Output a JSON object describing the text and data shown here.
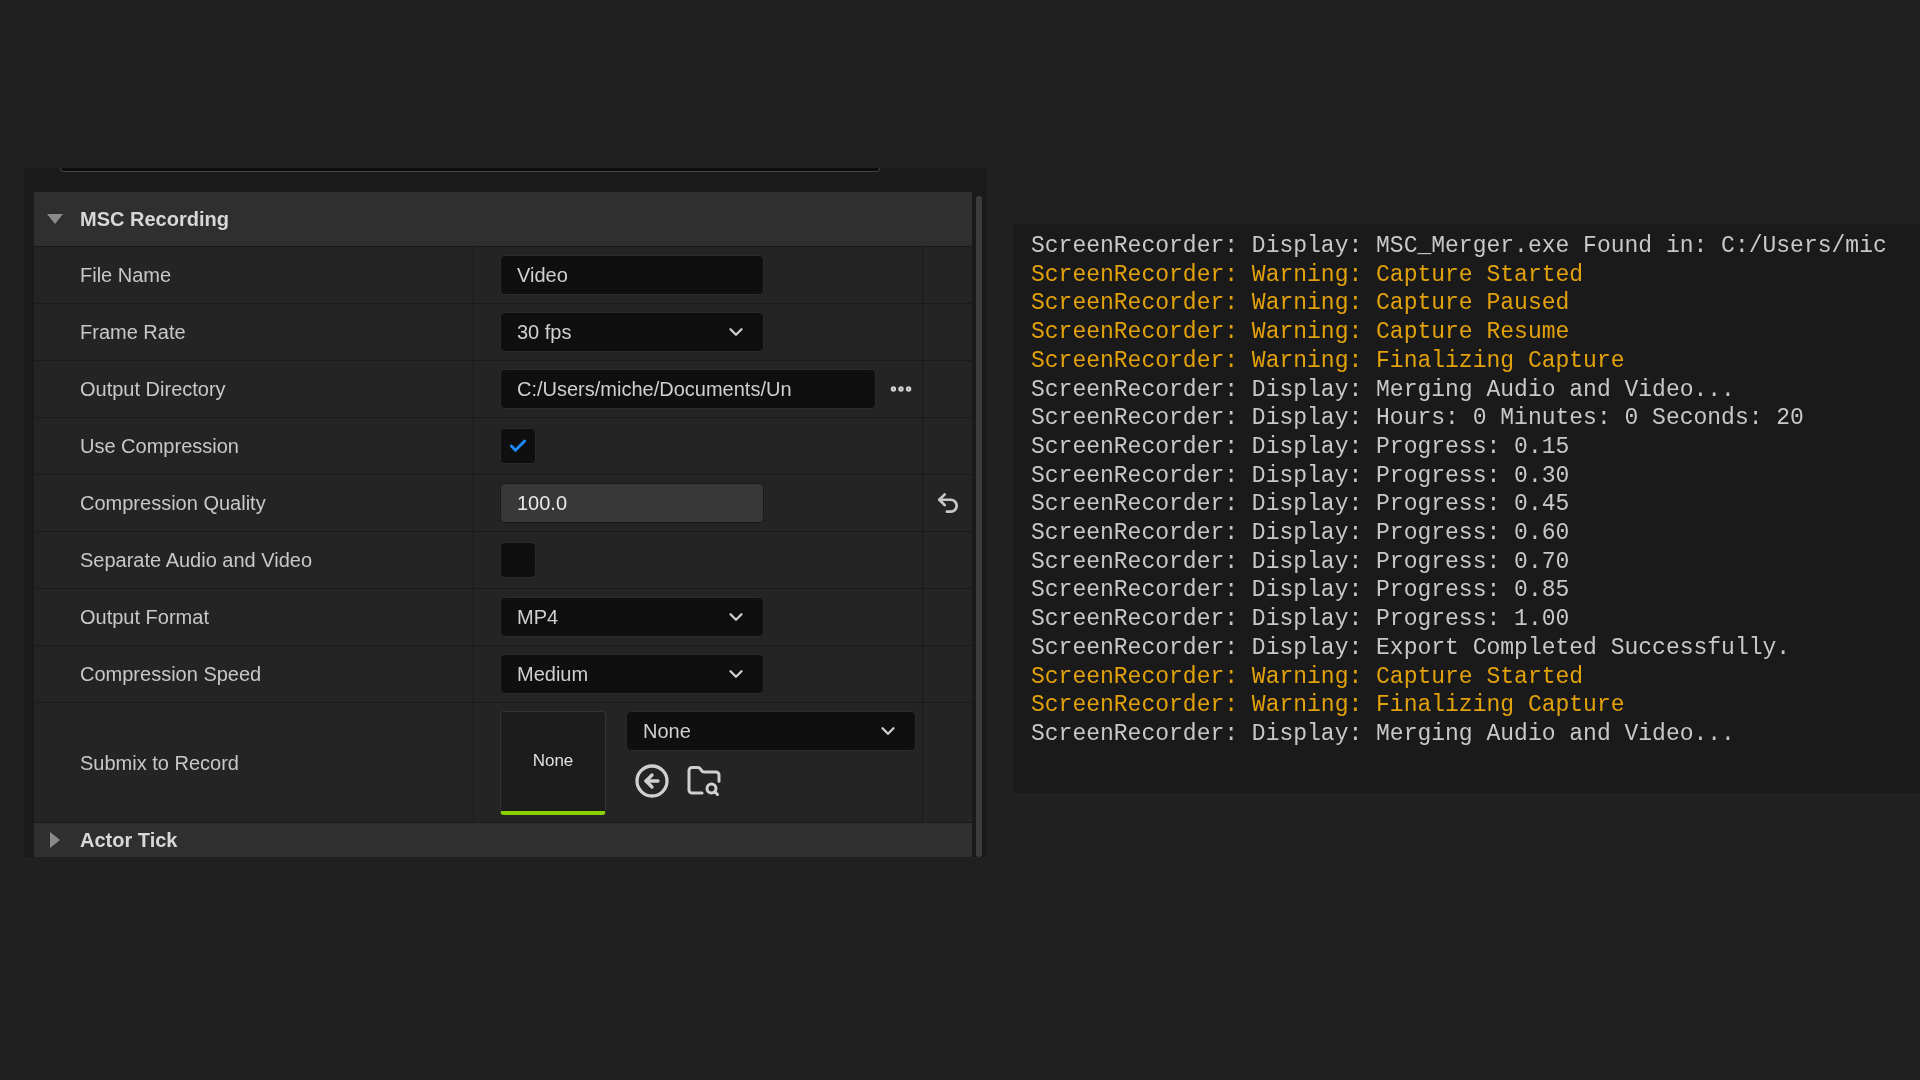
{
  "details_panel": {
    "section": {
      "title": "MSC Recording",
      "expanded": true
    },
    "properties": [
      {
        "label": "File Name",
        "kind": "text",
        "value": "Video",
        "modified": false
      },
      {
        "label": "Frame Rate",
        "kind": "dropdown",
        "value": "30 fps",
        "modified": false
      },
      {
        "label": "Output Directory",
        "kind": "path",
        "value": "C:/Users/miche/Documents/Un",
        "modified": false
      },
      {
        "label": "Use Compression",
        "kind": "checkbox",
        "checked": true,
        "modified": false
      },
      {
        "label": "Compression Quality",
        "kind": "number",
        "value": "100.0",
        "modified": true
      },
      {
        "label": "Separate Audio and Video",
        "kind": "checkbox",
        "checked": false,
        "modified": false
      },
      {
        "label": "Output Format",
        "kind": "dropdown",
        "value": "MP4",
        "modified": false
      },
      {
        "label": "Compression Speed",
        "kind": "dropdown",
        "value": "Medium",
        "modified": false
      },
      {
        "label": "Submix to Record",
        "kind": "asset",
        "thumbnail_label": "None",
        "value": "None",
        "modified": false
      }
    ],
    "next_section": {
      "title": "Actor Tick",
      "expanded": false
    }
  },
  "console": {
    "lines": [
      {
        "kind": "display",
        "text": "ScreenRecorder: Display: MSC_Merger.exe Found in: C:/Users/mic"
      },
      {
        "kind": "warning",
        "text": "ScreenRecorder: Warning: Capture Started"
      },
      {
        "kind": "warning",
        "text": "ScreenRecorder: Warning: Capture Paused"
      },
      {
        "kind": "warning",
        "text": "ScreenRecorder: Warning: Capture Resume"
      },
      {
        "kind": "warning",
        "text": "ScreenRecorder: Warning: Finalizing Capture"
      },
      {
        "kind": "display",
        "text": "ScreenRecorder: Display: Merging Audio and Video..."
      },
      {
        "kind": "display",
        "text": "ScreenRecorder: Display: Hours: 0 Minutes: 0 Seconds: 20"
      },
      {
        "kind": "display",
        "text": "ScreenRecorder: Display: Progress: 0.15"
      },
      {
        "kind": "display",
        "text": "ScreenRecorder: Display: Progress: 0.30"
      },
      {
        "kind": "display",
        "text": "ScreenRecorder: Display: Progress: 0.45"
      },
      {
        "kind": "display",
        "text": "ScreenRecorder: Display: Progress: 0.60"
      },
      {
        "kind": "display",
        "text": "ScreenRecorder: Display: Progress: 0.70"
      },
      {
        "kind": "display",
        "text": "ScreenRecorder: Display: Progress: 0.85"
      },
      {
        "kind": "display",
        "text": "ScreenRecorder: Display: Progress: 1.00"
      },
      {
        "kind": "display",
        "text": "ScreenRecorder: Display: Export Completed Successfully."
      },
      {
        "kind": "warning",
        "text": "ScreenRecorder: Warning: Capture Started"
      },
      {
        "kind": "warning",
        "text": "ScreenRecorder: Warning: Finalizing Capture"
      },
      {
        "kind": "display",
        "text": "ScreenRecorder: Display: Merging Audio and Video..."
      }
    ]
  }
}
